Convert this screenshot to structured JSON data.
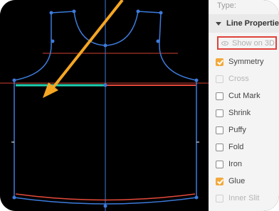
{
  "panel": {
    "type_label": "Type:",
    "section_title": "Line Properties",
    "show_on_3d": {
      "label": "Show on 3D",
      "enabled": false
    },
    "properties": [
      {
        "label": "Symmetry",
        "checked": true,
        "disabled": false
      },
      {
        "label": "Cross",
        "checked": false,
        "disabled": true
      },
      {
        "label": "Cut Mark",
        "checked": false,
        "disabled": false
      },
      {
        "label": "Shrink",
        "checked": false,
        "disabled": false
      },
      {
        "label": "Puffy",
        "checked": false,
        "disabled": false
      },
      {
        "label": "Fold",
        "checked": false,
        "disabled": false
      },
      {
        "label": "Iron",
        "checked": false,
        "disabled": false
      },
      {
        "label": "Glue",
        "checked": true,
        "disabled": false
      },
      {
        "label": "Inner Slit",
        "checked": false,
        "disabled": true
      }
    ]
  },
  "colors": {
    "pattern_outline": "#3d7bdc",
    "selected_line": "#1fd0b0",
    "glue_line": "#e64a3c",
    "annotation_arrow": "#f5a623",
    "highlight_box": "#e0403a",
    "checkbox_checked": "#f2a93b"
  }
}
